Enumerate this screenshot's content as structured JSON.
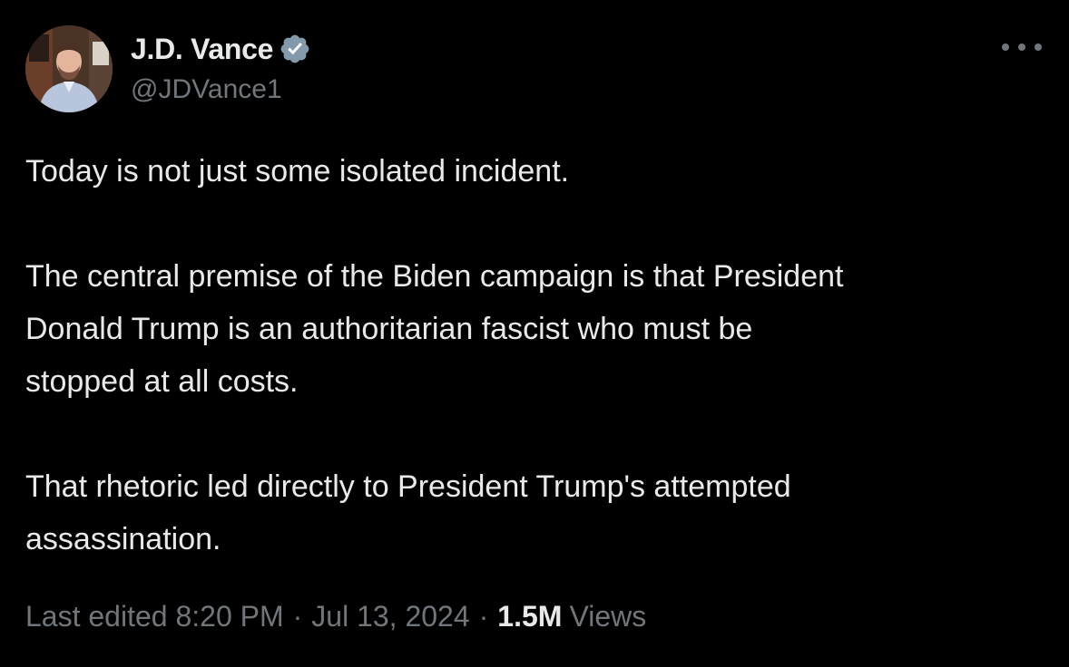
{
  "author": {
    "name": "J.D. Vance",
    "handle": "@JDVance1",
    "avatar_icon": "profile-photo",
    "verified_icon": "verified-badge-icon",
    "verified_color": "#829aab"
  },
  "tweet": {
    "paragraphs": [
      "Today is not just some isolated incident.",
      "The central premise of the Biden campaign is that President\nDonald Trump is an authoritarian fascist who must be\nstopped at all costs.",
      "That rhetoric led directly to President Trump's attempted\nassassination."
    ]
  },
  "meta": {
    "edited_label": "Last edited 8:20 PM",
    "separator": "·",
    "date": "Jul 13, 2024",
    "views_count": "1.5M",
    "views_label": "Views"
  },
  "menu": {
    "more_icon": "more-options-icon"
  },
  "colors": {
    "background": "#000000",
    "primary_text": "#e7e9ea",
    "secondary_text": "#71767b"
  }
}
